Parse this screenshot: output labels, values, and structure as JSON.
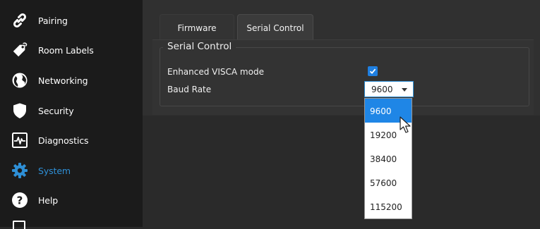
{
  "sidebar": {
    "items": [
      {
        "label": "Pairing",
        "icon": "link-icon",
        "active": false
      },
      {
        "label": "Room Labels",
        "icon": "tag-icon",
        "active": false
      },
      {
        "label": "Networking",
        "icon": "globe-icon",
        "active": false
      },
      {
        "label": "Security",
        "icon": "shield-icon",
        "active": false
      },
      {
        "label": "Diagnostics",
        "icon": "pulse-icon",
        "active": false
      },
      {
        "label": "System",
        "icon": "gear-icon",
        "active": true
      },
      {
        "label": "Help",
        "icon": "help-icon",
        "active": false
      }
    ]
  },
  "tabs": [
    {
      "label": "Firmware",
      "active": false
    },
    {
      "label": "Serial Control",
      "active": true
    }
  ],
  "serial_control": {
    "legend": "Serial Control",
    "enhanced_visca_label": "Enhanced VISCA mode",
    "enhanced_visca_checked": true,
    "baud_rate_label": "Baud Rate",
    "baud_rate_value": "9600",
    "baud_rate_options": [
      "9600",
      "19200",
      "38400",
      "57600",
      "115200"
    ],
    "baud_rate_highlighted": "9600"
  },
  "colors": {
    "accent": "#2e8fd6",
    "highlight": "#1f86e6",
    "sidebar_bg": "#1b1b1b",
    "panel_bg": "#333333"
  }
}
